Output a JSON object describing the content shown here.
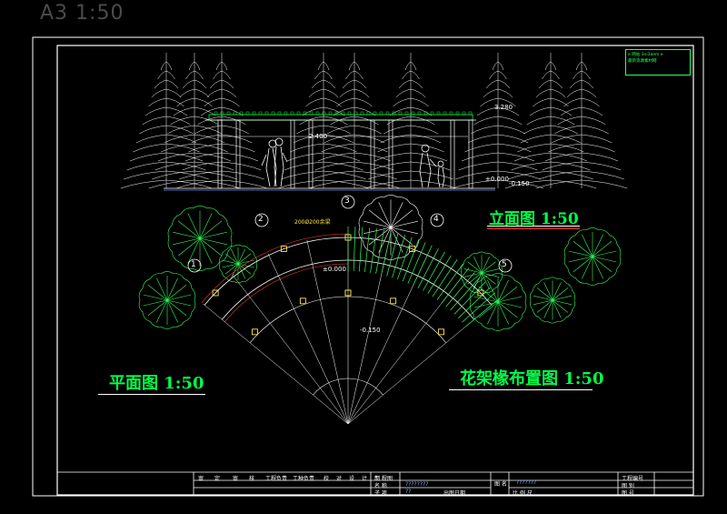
{
  "sheet": {
    "size_scale_label": "A3 1:50"
  },
  "views": {
    "elevation_title": "立面图 1:50",
    "plan_title": "平面图 1:50",
    "rafter_title": "花架椽布置图 1:50"
  },
  "stamp": {
    "line1": "e 网站 3ni3aem e",
    "line2": "最新资源素材网",
    "line3": "",
    "line4": ""
  },
  "elevation_dims": {
    "roof_level": "3.280",
    "beam_level": "2.400",
    "ground_level": "±0.000",
    "base_level": "-0.150"
  },
  "plan_dims": {
    "member_note": "200Ø200余梁",
    "center_level": "±0.000",
    "step_level": "-0.150"
  },
  "axes": [
    "1",
    "2",
    "3",
    "4",
    "5"
  ],
  "title_block": {
    "row1_labels": [
      "审",
      "定",
      "审",
      "核",
      "工程负责",
      "工种负责",
      "校",
      "对",
      "设",
      "计",
      "制",
      "图"
    ],
    "project_label": "工 程",
    "name_label": "名 称",
    "subitem_label": "子 项",
    "project_value": "????????",
    "subitem_value": "??",
    "drawing_date_label": "出图日期",
    "drawing_name_label": "图 名",
    "drawing_name_value": "???????",
    "scale_label": "比 例 尺",
    "project_no_label": "工程编号",
    "drawing_category_label": "图 别",
    "drawing_no_label": "图 号"
  },
  "colors": {
    "background": "#000000",
    "linework": "#ffffff",
    "green": "#00ff4a",
    "yellow": "#ffe74a",
    "red": "#ff3a3a",
    "blue": "#6f8bff"
  }
}
